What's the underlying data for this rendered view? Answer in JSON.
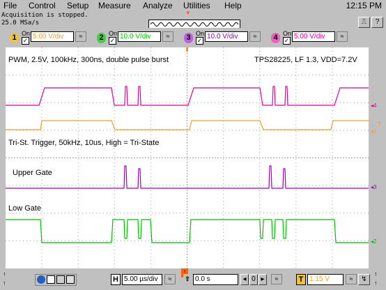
{
  "menu": {
    "items": [
      "File",
      "Control",
      "Setup",
      "Measure",
      "Analyze",
      "Utilities",
      "Help"
    ],
    "clock": "12:15 PM"
  },
  "status": {
    "line1": "Acquisition is stopped.",
    "line2": "25.0 MSa/s"
  },
  "channels": [
    {
      "num": "1",
      "on_label": "On",
      "scale": "5.00 V/div",
      "color": "#f0a020"
    },
    {
      "num": "2",
      "on_label": "On",
      "scale": "10.0 V/div",
      "color": "#00c000"
    },
    {
      "num": "3",
      "on_label": "On",
      "scale": "10.0 V/div",
      "color": "#a000c0"
    },
    {
      "num": "4",
      "on_label": "On",
      "scale": "5.00 V/div",
      "color": "#e000a0"
    }
  ],
  "annotations": {
    "top_left": "PWM, 2.5V, 100kHz, 300ns, double pulse burst",
    "top_right": "TPS28225, LF 1.3, VDD=7.2V",
    "tristate": "Tri-St. Trigger, 50kHz, 10us, High = Tri-State",
    "upper_gate": "Upper Gate",
    "low_gate": "Low Gate"
  },
  "markers": {
    "ch4": "4",
    "trig": "T",
    "ch1": "1",
    "ch3": "3",
    "ch2": "2"
  },
  "bottom": {
    "h_label": "H",
    "timebase": "5.00 µs/div",
    "delay": "0.0 s",
    "trigger_label": "T",
    "trigger_level": "1.15 V"
  },
  "colors": {
    "ch1": "#f0a020",
    "ch2": "#00c000",
    "ch3": "#a000c0",
    "ch4": "#e000a0",
    "grid": "#a0a0a0",
    "trigger_marker": "#ff6000"
  }
}
